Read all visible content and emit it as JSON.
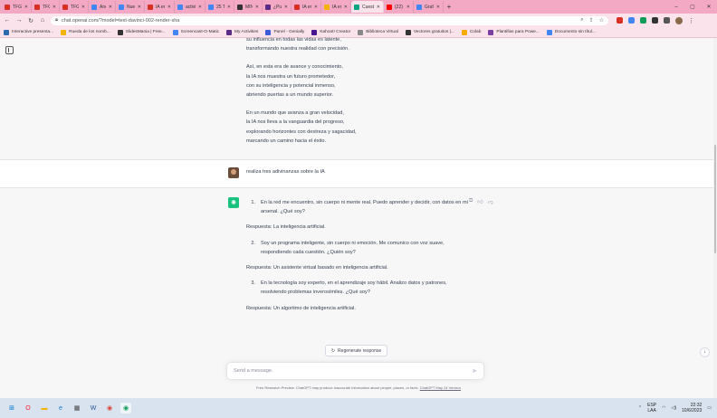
{
  "browser": {
    "tabs": [
      {
        "label": "TFG - A:",
        "color": "#d93025",
        "active": false
      },
      {
        "label": "TFG - M",
        "color": "#d93025",
        "active": false
      },
      {
        "label": "TFG - Co",
        "color": "#d93025",
        "active": false
      },
      {
        "label": "Anexo:",
        "color": "#4285f4",
        "active": false
      },
      {
        "label": "Nuevo",
        "color": "#4285f4",
        "active": false
      },
      {
        "label": "IA en el",
        "color": "#d93025",
        "active": false
      },
      {
        "label": "actividad",
        "color": "#4285f4",
        "active": false
      },
      {
        "label": "25 TARE",
        "color": "#4285f4",
        "active": false
      },
      {
        "label": "MINI-G",
        "color": "#333333",
        "active": false
      },
      {
        "label": "¿Puede",
        "color": "#5b2c83",
        "active": false
      },
      {
        "label": "IA en el",
        "color": "#d93025",
        "active": false
      },
      {
        "label": "IA en El",
        "color": "#f4b400",
        "active": false
      },
      {
        "label": "Cuestion",
        "color": "#10a37f",
        "active": true
      },
      {
        "label": "(22) Ejer",
        "color": "#ff0000",
        "active": false
      },
      {
        "label": "Grafico",
        "color": "#4285f4",
        "active": false
      }
    ],
    "new_tab": "+",
    "window_controls": [
      "–",
      "▢",
      "✕"
    ],
    "url": "chat.openai.com/?model=text-davinci-002-render-sha",
    "bookmarks": [
      {
        "label": "Interactive presenta...",
        "color": "#2b6cb0"
      },
      {
        "label": "Rueda de los nomb...",
        "color": "#f4b400"
      },
      {
        "label": "SlidesMania | Free...",
        "color": "#333333"
      },
      {
        "label": "Screencast-O-Matic",
        "color": "#4285f4"
      },
      {
        "label": "My Activities",
        "color": "#5b2c83"
      },
      {
        "label": "Panel - Genially",
        "color": "#3b5bdb"
      },
      {
        "label": "Kahoot! Creator",
        "color": "#46178f"
      },
      {
        "label": "Biblioteca Virtual",
        "color": "#888888"
      },
      {
        "label": "Vectores gratuitos |...",
        "color": "#333333"
      },
      {
        "label": "Colab",
        "color": "#f9ab00"
      },
      {
        "label": "Plantillas para Powe...",
        "color": "#7b3fa0"
      },
      {
        "label": "Documento sin títul...",
        "color": "#4285f4"
      }
    ]
  },
  "chat": {
    "previous_poem": [
      [
        "su influencia en todas las vidas es latente,",
        "transformando nuestra realidad con precisión."
      ],
      [
        "Así, en esta era de avance y conocimiento,",
        "la IA nos muestra un futuro prometedor,",
        "con su inteligencia y potencial inmenso,",
        "abriendo puertas a un mundo superior."
      ],
      [
        "En un mundo que avanza a gran velocidad,",
        "la IA nos lleva a la vanguardia del progreso,",
        "explorando horizontes con destreza y sagacidad,",
        "marcando un camino hacia el éxito."
      ]
    ],
    "user_message": "realiza tres adivinanzas sobre la IA",
    "answer": [
      {
        "num": "1.",
        "riddle": "En la red me encuentro, sin cuerpo ni mente real. Puedo aprender y decidir, con datos en mi arsenal. ¿Qué soy?",
        "response": "Respuesta: La inteligencia artificial."
      },
      {
        "num": "2.",
        "riddle": "Soy un programa inteligente, sin cuerpo ni emoción. Me comunico con voz suave, respondiendo cada cuestión. ¿Quién soy?",
        "response": "Respuesta: Un asistente virtual basado en inteligencia artificial."
      },
      {
        "num": "3.",
        "riddle": "En la tecnología soy experto, en el aprendizaje soy hábil. Analizo datos y patrones, resolviendo problemas inverosímiles. ¿Qué soy?",
        "response": "Respuesta: Un algoritmo de inteligencia artificial."
      }
    ],
    "regenerate_label": "Regenerate response",
    "composer_placeholder": "Send a message.",
    "disclaimer": "Free Research Preview. ChatGPT may produce inaccurate information about people, places, or facts.",
    "disclaimer_link": "ChatGPT May 24 Version"
  },
  "taskbar": {
    "apps": [
      {
        "name": "windows-start-icon",
        "glyph": "⊞",
        "color": "#0078d4"
      },
      {
        "name": "opera-icon",
        "glyph": "O",
        "color": "#ff1b2d"
      },
      {
        "name": "file-explorer-icon",
        "glyph": "▬",
        "color": "#f4b400"
      },
      {
        "name": "edge-icon",
        "glyph": "e",
        "color": "#0c7bdc"
      },
      {
        "name": "calculator-icon",
        "glyph": "▦",
        "color": "#444444"
      },
      {
        "name": "word-icon",
        "glyph": "W",
        "color": "#2b579a"
      },
      {
        "name": "chrome-icon",
        "glyph": "◉",
        "color": "#db4437"
      },
      {
        "name": "chrome-active-icon",
        "glyph": "◉",
        "color": "#0f9d58"
      }
    ],
    "language": [
      "ESP",
      "LAA"
    ],
    "time": "22:32",
    "date": "10/6/2023"
  }
}
